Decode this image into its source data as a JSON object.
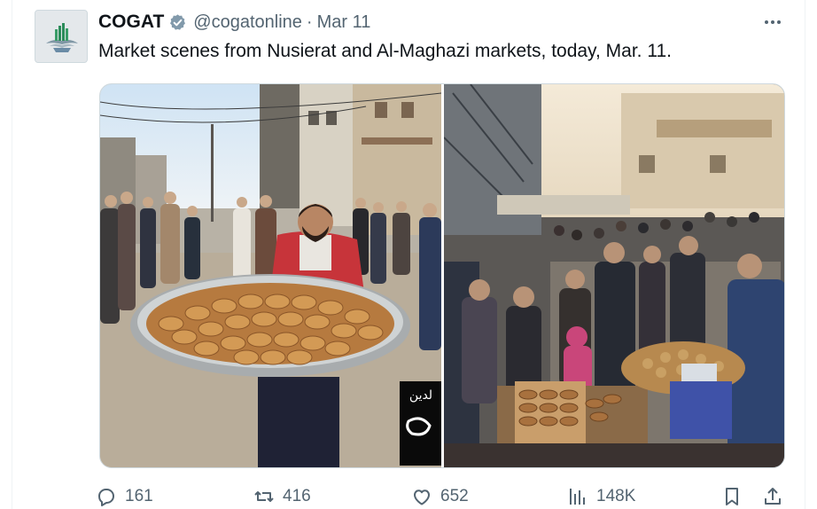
{
  "tweet": {
    "display_name": "COGAT",
    "verified_icon": "verified-badge-icon",
    "handle": "@cogatonline",
    "separator": "·",
    "date": "Mar 11",
    "text": "Market scenes from Nusierat and Al-Maghazi markets, today, Mar. 11.",
    "more_icon": "more-options-icon"
  },
  "media": {
    "images": [
      {
        "icon": "photo-vendor-pastry-tray"
      },
      {
        "icon": "photo-market-crowd"
      }
    ],
    "watermark_text": "لدين"
  },
  "actions": {
    "replies": {
      "icon": "reply-icon",
      "count": "161"
    },
    "reposts": {
      "icon": "repost-icon",
      "count": "416"
    },
    "likes": {
      "icon": "like-icon",
      "count": "652"
    },
    "views": {
      "icon": "views-icon",
      "count": "148K"
    },
    "bookmark": {
      "icon": "bookmark-icon"
    },
    "share": {
      "icon": "share-icon"
    }
  },
  "colors": {
    "text_primary": "#0f1419",
    "text_secondary": "#536471",
    "verified": "#829aab",
    "border": "#cfd9de"
  }
}
